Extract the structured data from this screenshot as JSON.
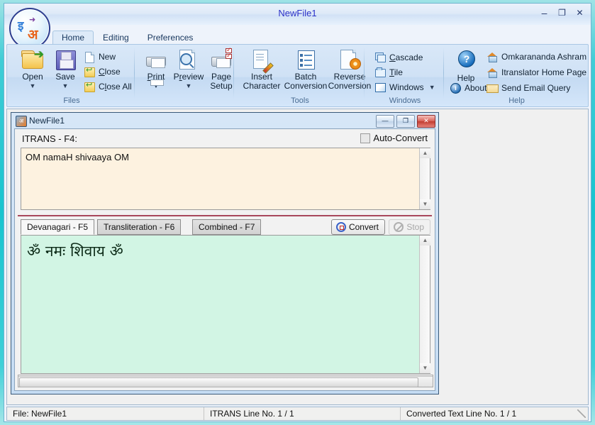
{
  "window": {
    "title": "NewFile1",
    "minimize_label": "–",
    "maximize_label": "❐",
    "close_label": "✕"
  },
  "logo": {
    "glyph_top": "इ",
    "glyph_bottom": "अ",
    "arrow_right": "➜",
    "arrow_left": "➜"
  },
  "ribbon": {
    "tabs": [
      {
        "label": "Home",
        "active": true
      },
      {
        "label": "Editing",
        "active": false
      },
      {
        "label": "Preferences",
        "active": false
      }
    ],
    "groups": [
      {
        "name": "Files",
        "title": "Files",
        "big_buttons": [
          {
            "label": "Open",
            "icon": "open-folder-icon",
            "has_dropdown": true
          },
          {
            "label": "Save",
            "icon": "floppy-disk-icon",
            "has_dropdown": true
          }
        ],
        "small_items": [
          {
            "label": "New",
            "icon": "new-page-icon"
          },
          {
            "label": "Close",
            "icon": "close-undo-icon"
          },
          {
            "label": "Close All",
            "icon": "close-all-undo-icon"
          }
        ]
      },
      {
        "name": "Print",
        "title": "",
        "big_buttons": [
          {
            "label": "Print",
            "icon": "printer-icon",
            "has_dropdown": true
          },
          {
            "label": "Preview",
            "icon": "print-preview-icon",
            "has_dropdown": true
          },
          {
            "label": "Page Setup",
            "icon": "page-setup-icon",
            "has_dropdown": false
          }
        ]
      },
      {
        "name": "Tools",
        "title": "Tools",
        "big_buttons": [
          {
            "label": "Insert Character",
            "icon": "insert-character-icon"
          },
          {
            "label": "Batch Conversion",
            "icon": "batch-conversion-icon"
          },
          {
            "label": "Reverse Conversion",
            "icon": "reverse-conversion-icon"
          }
        ]
      },
      {
        "name": "Windows",
        "title": "Windows",
        "small_items": [
          {
            "label": "Cascade",
            "icon": "cascade-icon"
          },
          {
            "label": "Tile",
            "icon": "tile-icon"
          },
          {
            "label": "Windows",
            "icon": "windows-icon",
            "has_dropdown": true
          }
        ]
      },
      {
        "name": "Help",
        "title": "Help",
        "help_label": "Help",
        "help_glyph": "?",
        "about_label": "About",
        "about_glyph": "i",
        "links": [
          {
            "label": "Omkarananda Ashram",
            "icon": "house-icon"
          },
          {
            "label": "Itranslator Home Page",
            "icon": "house-icon"
          },
          {
            "label": "Send Email Query",
            "icon": "envelope-icon"
          }
        ]
      }
    ]
  },
  "child_window": {
    "title": "NewFile1",
    "minimize_label": "—",
    "restore_label": "❐",
    "close_label": "✕",
    "input_label": "ITRANS - F4:",
    "auto_convert_label": "Auto-Convert",
    "auto_convert_checked": false,
    "input_text": "OM namaH shivaaya OM",
    "tabs": [
      {
        "label": "Devanagari - F5",
        "active": true
      },
      {
        "label": "Transliteration - F6",
        "active": false
      },
      {
        "label": "Combined - F7",
        "active": false
      }
    ],
    "convert_label": "Convert",
    "stop_label": "Stop",
    "stop_enabled": false,
    "output_text": "ॐ नमः शिवाय ॐ"
  },
  "statusbar": {
    "file": "File: NewFile1",
    "itrans_line": "ITRANS Line No. 1 / 1",
    "converted_line": "Converted Text Line No. 1 / 1"
  },
  "colors": {
    "frame_teal": "#18c4cf",
    "title_text": "#2b31c8",
    "input_bg": "#fdf2e0",
    "output_bg": "#d2f5e4",
    "divider_red": "#a8475c"
  }
}
